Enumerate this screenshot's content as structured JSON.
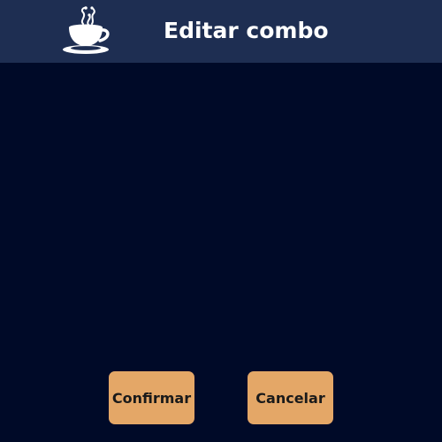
{
  "header": {
    "title": "Editar combo",
    "logo_icon": "coffee-cup-icon"
  },
  "actions": {
    "confirm_label": "Confirmar",
    "cancel_label": "Cancelar"
  },
  "colors": {
    "header_bg": "#1e2e52",
    "page_bg": "#000a28",
    "button_bg": "#e4a767",
    "button_text": "#1a1a1a",
    "title_text": "#ffffff"
  }
}
